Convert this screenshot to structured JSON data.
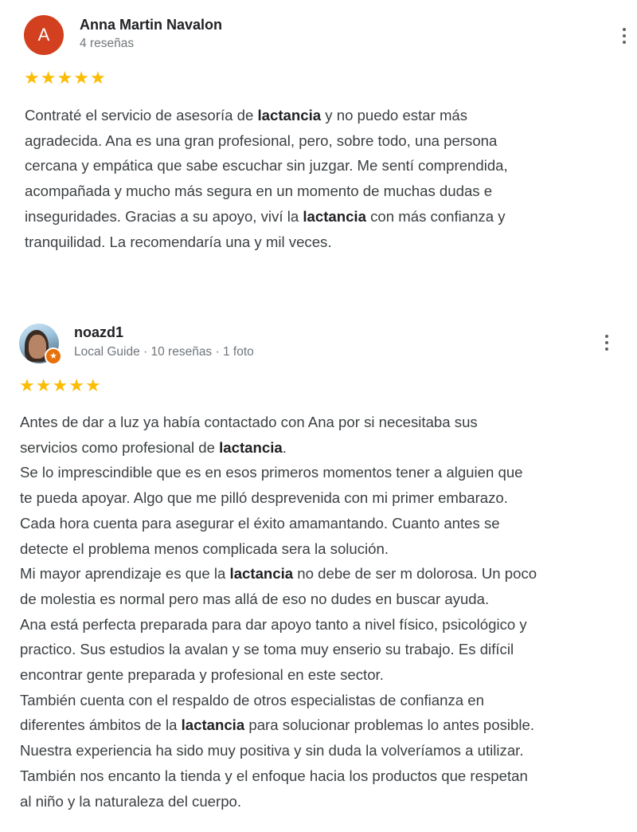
{
  "reviews": [
    {
      "avatar_letter": "A",
      "avatar_color": "#d2401f",
      "name": "Anna Martin Navalon",
      "sub": "4 reseñas",
      "rating": 5,
      "menu_icon": "more-vert-icon",
      "lines": [
        [
          "Contraté el servicio de asesoría de ",
          "lactancia",
          " y no puedo estar más"
        ],
        [
          "agradecida. Ana es una gran profesional, pero, sobre todo, una persona",
          "",
          ""
        ],
        [
          "cercana y empática que sabe escuchar sin juzgar. Me sentí comprendida,",
          "",
          ""
        ],
        [
          "acompañada y mucho más segura en un momento de muchas dudas e",
          "",
          ""
        ],
        [
          "inseguridades. Gracias a su apoyo, viví la ",
          "lactancia",
          " con más confianza y"
        ],
        [
          "tranquilidad. La recomendaría una y mil veces.",
          "",
          ""
        ]
      ]
    },
    {
      "name": "noazd1",
      "sub": "Local Guide · 10 reseñas · 1 foto",
      "rating": 5,
      "menu_icon": "more-vert-icon",
      "badge_icon": "local-guide-star-icon",
      "badge_color": "#e8710a",
      "lines": [
        [
          "Antes de dar a luz ya había contactado con Ana por si necesitaba sus",
          "",
          ""
        ],
        [
          "servicios como profesional de ",
          "lactancia",
          "."
        ],
        [
          "Se lo imprescindible que es en esos primeros momentos tener a alguien que",
          "",
          ""
        ],
        [
          "te pueda apoyar. Algo que me pilló desprevenida con mi primer embarazo.",
          "",
          ""
        ],
        [
          "Cada hora cuenta para asegurar el éxito amamantando. Cuanto antes se",
          "",
          ""
        ],
        [
          "detecte el problema menos complicada sera la solución.",
          "",
          ""
        ],
        [
          "Mi mayor aprendizaje es que la ",
          "lactancia",
          " no debe de ser m dolorosa. Un poco"
        ],
        [
          "de molestia es normal pero mas allá de eso no dudes en buscar ayuda.",
          "",
          ""
        ],
        [
          "Ana está perfecta preparada para dar apoyo tanto a nivel físico, psicológico y",
          "",
          ""
        ],
        [
          "practico. Sus estudios la avalan y se toma muy enserio su trabajo. Es difícil",
          "",
          ""
        ],
        [
          "encontrar gente preparada y profesional en este sector.",
          "",
          ""
        ],
        [
          "También cuenta con el respaldo de otros especialistas de confianza en",
          "",
          ""
        ],
        [
          "diferentes ámbitos de la ",
          "lactancia",
          " para solucionar problemas lo antes posible."
        ],
        [
          "Nuestra experiencia ha sido muy positiva y sin duda la volveríamos a utilizar.",
          "",
          ""
        ],
        [
          "También nos encanto la tienda y el enfoque hacia los productos que respetan",
          "",
          ""
        ],
        [
          "al niño y la naturaleza del cuerpo.",
          "",
          ""
        ]
      ]
    }
  ],
  "colors": {
    "star": "#fbbc04",
    "name": "#202124",
    "body_text": "#3c4043",
    "secondary_text": "#70757a"
  }
}
